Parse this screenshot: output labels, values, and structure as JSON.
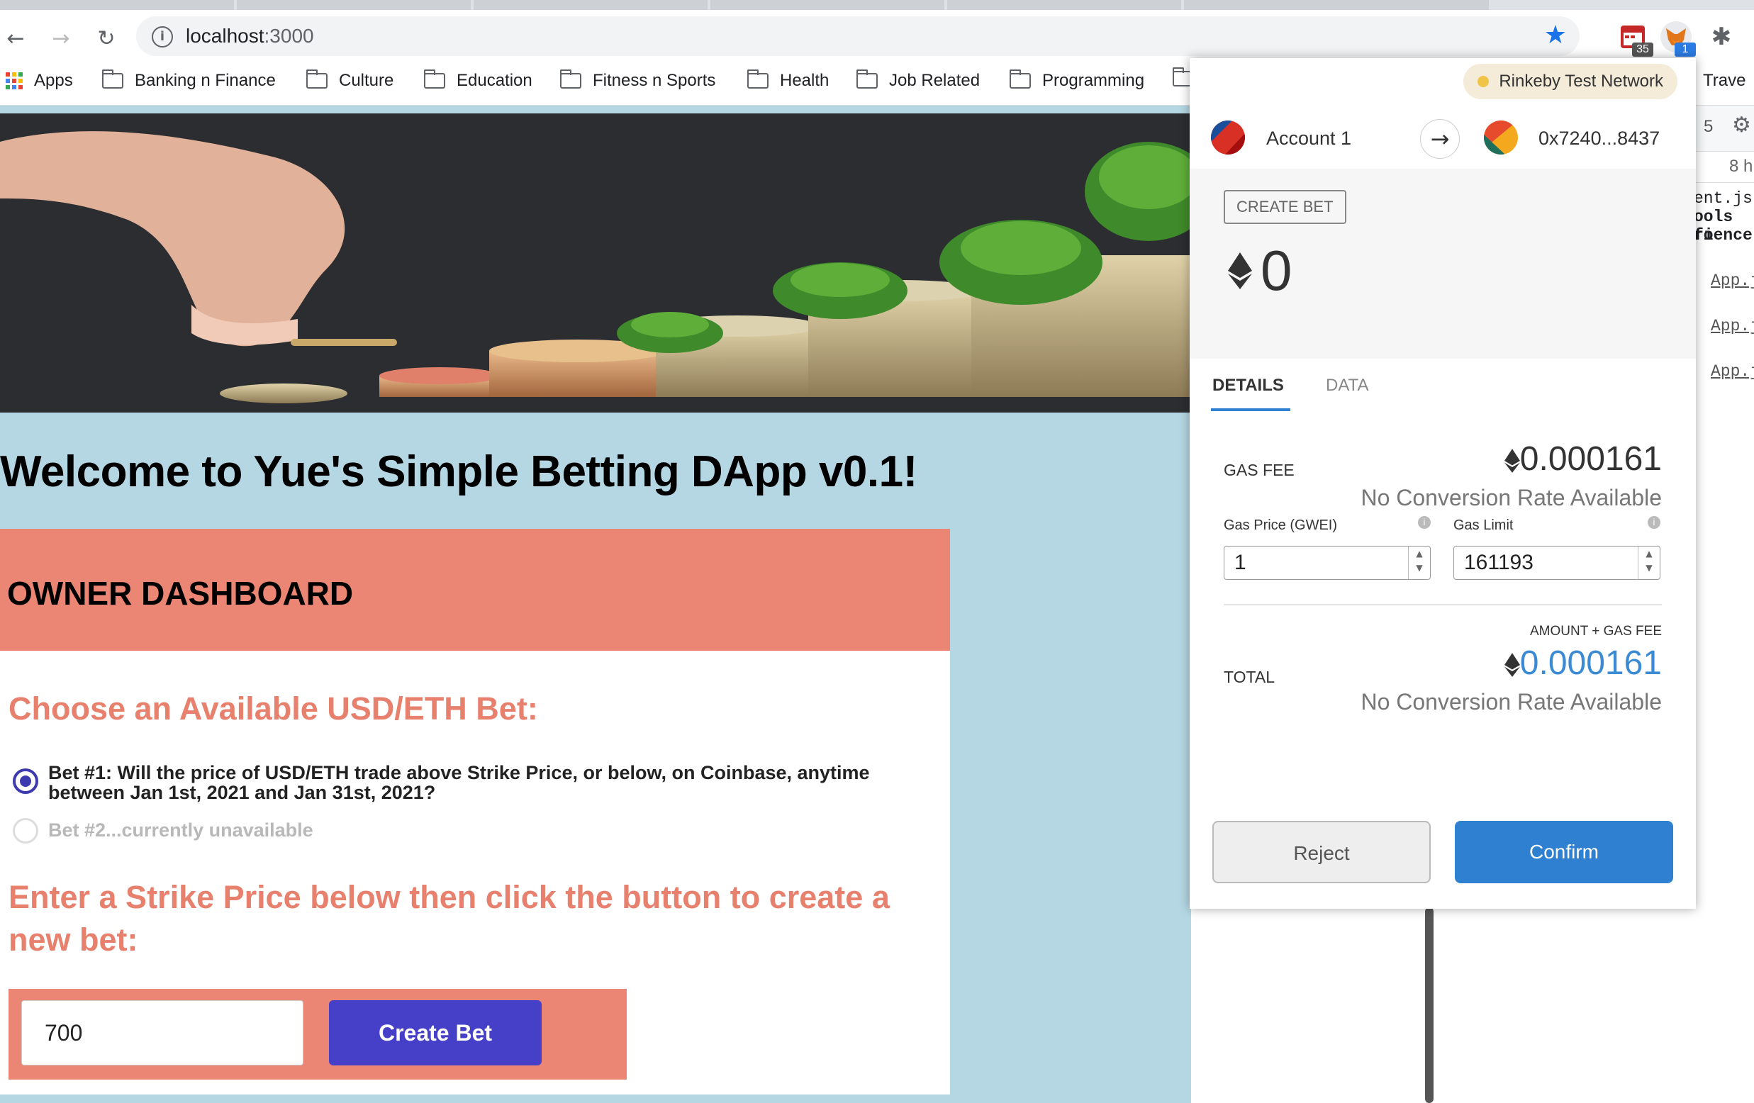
{
  "browser": {
    "url_host": "localhost",
    "url_port": ":3000",
    "extension_badges": {
      "calendar": "35",
      "metamask": "1"
    }
  },
  "bookmarks": {
    "apps_label": "Apps",
    "folders": [
      "Banking n Finance",
      "Culture",
      "Education",
      "Fitness n Sports",
      "Health",
      "Job Related",
      "Programming"
    ],
    "overflow_label": "Trave"
  },
  "page": {
    "welcome_title": "Welcome to Yue's Simple Betting DApp v0.1!",
    "dashboard_title": "OWNER DASHBOARD",
    "choose_heading": "Choose an Available USD/ETH Bet:",
    "bet1_line1": "Bet #1: Will the price of USD/ETH trade above Strike Price, or below, on Coinbase, anytime",
    "bet1_line2": "between Jan 1st, 2021 and Jan 31st, 2021?",
    "bet2_label": "Bet #2...currently unavailable",
    "strike_heading_line1": "Enter a Strike Price below then click the button to create a",
    "strike_heading_line2": "new bet:",
    "strike_value": "700",
    "create_button": "Create Bet"
  },
  "devtools": {
    "lines": [
      "ent.js:",
      "ools fo",
      "rience:",
      "App.j",
      "App.j",
      "App.j"
    ],
    "count": "5",
    "time": "8 h"
  },
  "metamask": {
    "network": "Rinkeby Test Network",
    "from_account": "Account 1",
    "to_address": "0x7240...8437",
    "method_tag": "CREATE BET",
    "amount": "0",
    "tabs": [
      "DETAILS",
      "DATA"
    ],
    "gas_fee_label": "GAS FEE",
    "gas_fee_value": "0.000161",
    "no_rate": "No Conversion Rate Available",
    "gas_price_label": "Gas Price (GWEI)",
    "gas_limit_label": "Gas Limit",
    "gas_price_value": "1",
    "gas_limit_value": "161193",
    "amount_plus_gas": "AMOUNT + GAS FEE",
    "total_label": "TOTAL",
    "total_value": "0.000161",
    "reject": "Reject",
    "confirm": "Confirm",
    "colors": {
      "accent": "#2f80d1",
      "total": "#3b8bd4"
    }
  }
}
